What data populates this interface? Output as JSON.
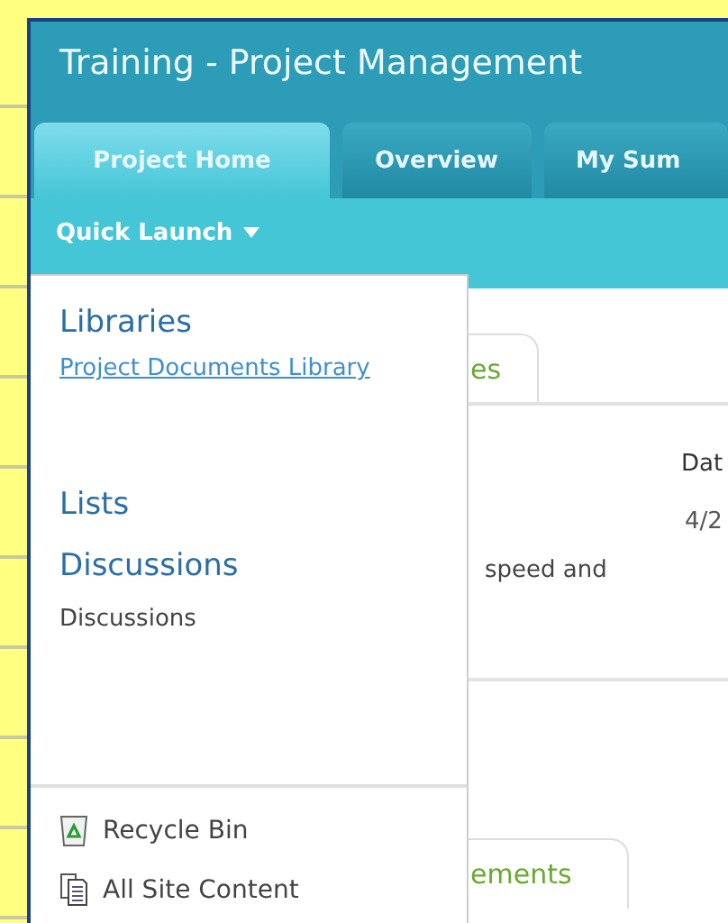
{
  "window": {
    "title": "Training - Project Management"
  },
  "tabs": [
    {
      "label": "Project Home",
      "selected": true
    },
    {
      "label": "Overview",
      "selected": false
    },
    {
      "label": "My Sum",
      "selected": false
    }
  ],
  "quick_launch": {
    "label": "Quick Launch"
  },
  "menu": {
    "items": [
      {
        "kind": "heading",
        "label": "Libraries"
      },
      {
        "kind": "link",
        "label": "Project Documents Library"
      },
      {
        "kind": "heading",
        "label": "Lists"
      },
      {
        "kind": "heading",
        "label": "Discussions"
      },
      {
        "kind": "item",
        "label": "Discussions"
      }
    ],
    "footer": [
      {
        "kind": "recycle-bin",
        "label": "Recycle Bin"
      },
      {
        "kind": "site-content",
        "label": "All Site Content"
      }
    ]
  },
  "background": {
    "tab_1": "es",
    "column_header": "Dat",
    "date": "4/2",
    "text": "speed and",
    "tab_2": "ements"
  }
}
